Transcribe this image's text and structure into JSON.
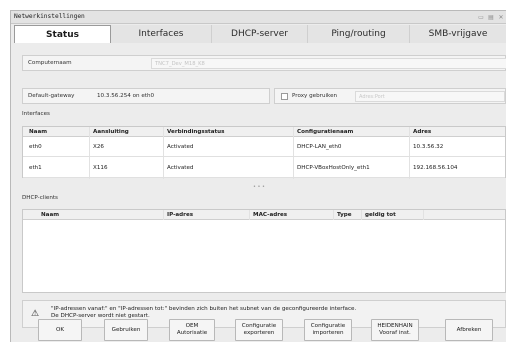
{
  "window": {
    "title": "Netwerkinstellingen",
    "controls": [
      "▭",
      "▤",
      "✕"
    ]
  },
  "tabs": [
    {
      "label": "Status",
      "active": true
    },
    {
      "label": "Interfaces",
      "active": false
    },
    {
      "label": "DHCP-server",
      "active": false
    },
    {
      "label": "Ping/routing",
      "active": false
    },
    {
      "label": "SMB-vrijgave",
      "active": false
    }
  ],
  "computer": {
    "label": "Computernaam",
    "value": "TNC7_Dev_M18_K8"
  },
  "gateway": {
    "label": "Default-gateway",
    "value": "10.3.56.254 on eth0"
  },
  "proxy": {
    "checkbox_label": "Proxy gebruiken",
    "placeholder": "Adres:Port"
  },
  "interfaces": {
    "title": "Interfaces",
    "columns": [
      "Naam",
      "Aansluiting",
      "Verbindingsstatus",
      "Configuratienaam",
      "Adres"
    ],
    "rows": [
      [
        "eth0",
        "X26",
        "Activated",
        "DHCP-LAN_eth0",
        "10.3.56.32"
      ],
      [
        "eth1",
        "X116",
        "Activated",
        "DHCP-VBoxHostOnly_eth1",
        "192.168.56.104"
      ]
    ]
  },
  "splitter_glyph": "• • •",
  "dhcp_clients": {
    "title": "DHCP-clients",
    "columns": [
      "Naam",
      "IP-adres",
      "MAC-adres",
      "Type",
      "geldig tot"
    ]
  },
  "warning": {
    "icon": "warning-icon",
    "line1": "\"IP-adressen vanaf:\" en \"IP-adressen tot:\" bevinden zich buiten het subnet van de geconfigureerde interface.",
    "line2": "De DHCP-server wordt niet gestart."
  },
  "buttons": {
    "ok": "OK",
    "apply": "Gebruiken",
    "oem": "OEM\nAutorisatie",
    "export": "Configuratie\nexporteren",
    "import": "Configuratie\nimporteren",
    "heidenhain": "HEIDENHAIN\nVooraf inst.",
    "cancel": "Afbreken"
  }
}
